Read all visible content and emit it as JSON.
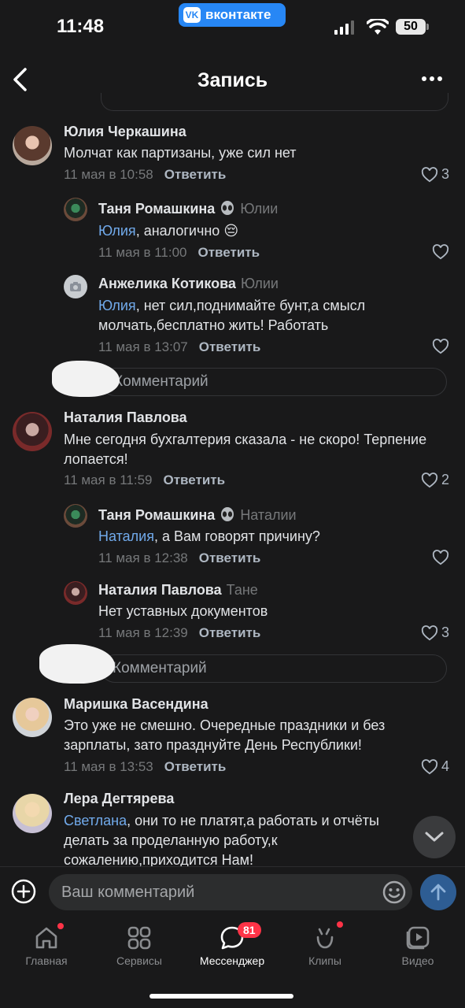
{
  "status_bar": {
    "time": "11:48",
    "app_pill": "вконтакте",
    "app_logo": "VK",
    "battery": "50"
  },
  "header": {
    "title": "Запись"
  },
  "comments": [
    {
      "author": "Юлия Черкашина",
      "text": "Молчат как партизаны, уже сил нет",
      "time": "11 мая в 10:58",
      "reply_label": "Ответить",
      "likes": "3",
      "replies": [
        {
          "author": "Таня Ромашкина",
          "to": "Юлии",
          "mention": "Юлия",
          "text": ", аналогично 😔",
          "time": "11 мая в 11:00",
          "reply_label": "Ответить",
          "likes": ""
        },
        {
          "author": "Анжелика Котикова",
          "to": "Юлии",
          "mention": "Юлия",
          "text": ", нет сил,поднимайте бунт,а смысл молчать,бесплатно жить! Работать",
          "time": "11 мая в 13:07",
          "reply_label": "Ответить",
          "likes": ""
        }
      ],
      "input_placeholder": "Комментарий"
    },
    {
      "author": "Наталия Павлова",
      "text": "Мне сегодня бухгалтерия сказала - не скоро! Терпение лопается!",
      "time": "11 мая в 11:59",
      "reply_label": "Ответить",
      "likes": "2",
      "replies": [
        {
          "author": "Таня Ромашкина",
          "to": "Наталии",
          "mention": "Наталия",
          "text": ", а Вам говорят причину?",
          "time": "11 мая в 12:38",
          "reply_label": "Ответить",
          "likes": ""
        },
        {
          "author": "Наталия Павлова",
          "to": "Тане",
          "mention": "",
          "text": "Нет уставных документов",
          "time": "11 мая в 12:39",
          "reply_label": "Ответить",
          "likes": "3"
        }
      ],
      "input_placeholder": "Комментарий"
    },
    {
      "author": "Маришка Васендина",
      "text": "Это уже не смешно. Очередные праздники и без зарплаты, зато празднуйте День Республики!",
      "time": "11 мая в 13:53",
      "reply_label": "Ответить",
      "likes": "4"
    },
    {
      "author": "Лера Дегтярева",
      "mention": "Светлана",
      "text": ", они то не платят,а работать и отчёты делать за проделанную работу,к сожалению,приходится Нам!"
    }
  ],
  "composer": {
    "placeholder": "Ваш комментарий"
  },
  "tabs": [
    {
      "label": "Главная",
      "icon": "home-icon"
    },
    {
      "label": "Сервисы",
      "icon": "services-icon"
    },
    {
      "label": "Мессенджер",
      "icon": "messenger-icon",
      "badge": "81"
    },
    {
      "label": "Клипы",
      "icon": "clips-icon"
    },
    {
      "label": "Видео",
      "icon": "video-icon"
    }
  ],
  "colors": {
    "background": "#19191a",
    "accent": "#71aaeb",
    "badge": "#ff3347",
    "send": "#2e5d93"
  }
}
